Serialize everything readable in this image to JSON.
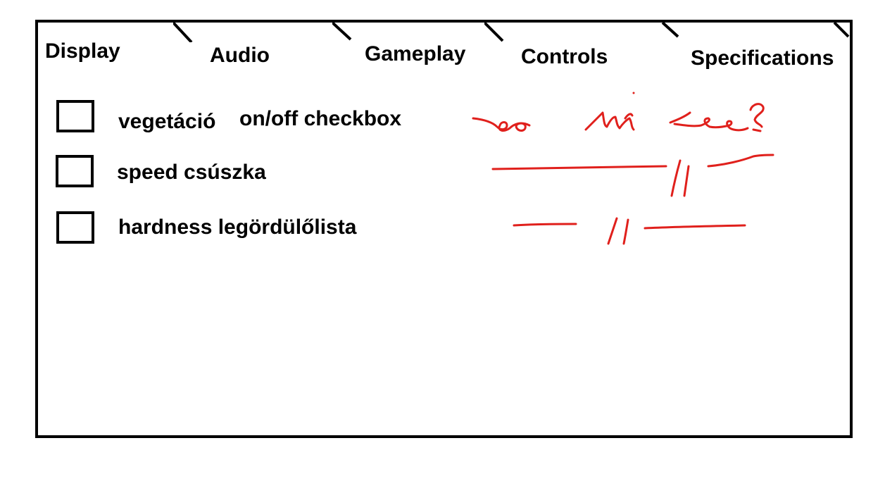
{
  "tabs": [
    {
      "label": "Display"
    },
    {
      "label": "Audio"
    },
    {
      "label": "Gameplay"
    },
    {
      "label": "Controls"
    },
    {
      "label": "Specifications"
    }
  ],
  "settings": [
    {
      "label": "vegetáció",
      "note": "on/off checkbox",
      "checked": false
    },
    {
      "label": "speed csúszka",
      "checked": false
    },
    {
      "label": "hardness legördülőlista",
      "checked": false
    }
  ],
  "colors": {
    "ink": "#000000",
    "annotation": "#e0201c",
    "background": "#ffffff"
  }
}
